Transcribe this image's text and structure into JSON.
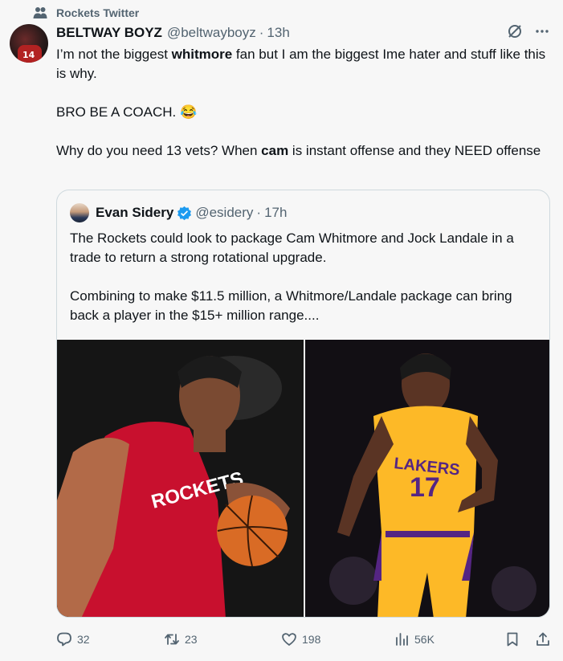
{
  "community": {
    "label": "Rockets Twitter",
    "icon": "community-icon"
  },
  "tweet": {
    "author_name": "BELTWAY BOYZ",
    "author_handle": "@beltwayboyz",
    "separator": "·",
    "time": "13h",
    "paragraphs": [
      {
        "pre": "I’m not the biggest ",
        "bold": "whitmore",
        "post": " fan but I am the biggest Ime hater and stuff like this is why."
      },
      {
        "text": "BRO BE A COACH. 😂"
      },
      {
        "pre": "Why do you need 13 vets? When ",
        "bold": "cam",
        "post": " is instant offense and they NEED offense"
      }
    ]
  },
  "quote": {
    "author_name": "Evan Sidery",
    "author_handle": "@esidery",
    "separator": "·",
    "time": "17h",
    "paragraphs": [
      "The Rockets could look to package Cam Whitmore and Jock Landale in a trade to return a strong rotational upgrade.",
      "Combining to make $11.5 million, a Whitmore/Landale package can bring back a player in the $15+ million range...."
    ],
    "images": [
      {
        "name": "rockets-player-photo",
        "team_text": "ROCKETS"
      },
      {
        "name": "lakers-player-photo",
        "team_text": "LAKERS",
        "number": "17"
      }
    ]
  },
  "metrics": {
    "replies": "32",
    "retweets": "23",
    "likes": "198",
    "views": "56K"
  },
  "colors": {
    "text_primary": "#0f1419",
    "text_secondary": "#536471",
    "verified_blue": "#1d9bf0",
    "border": "#cfd9de",
    "background": "#f7f7f7"
  }
}
